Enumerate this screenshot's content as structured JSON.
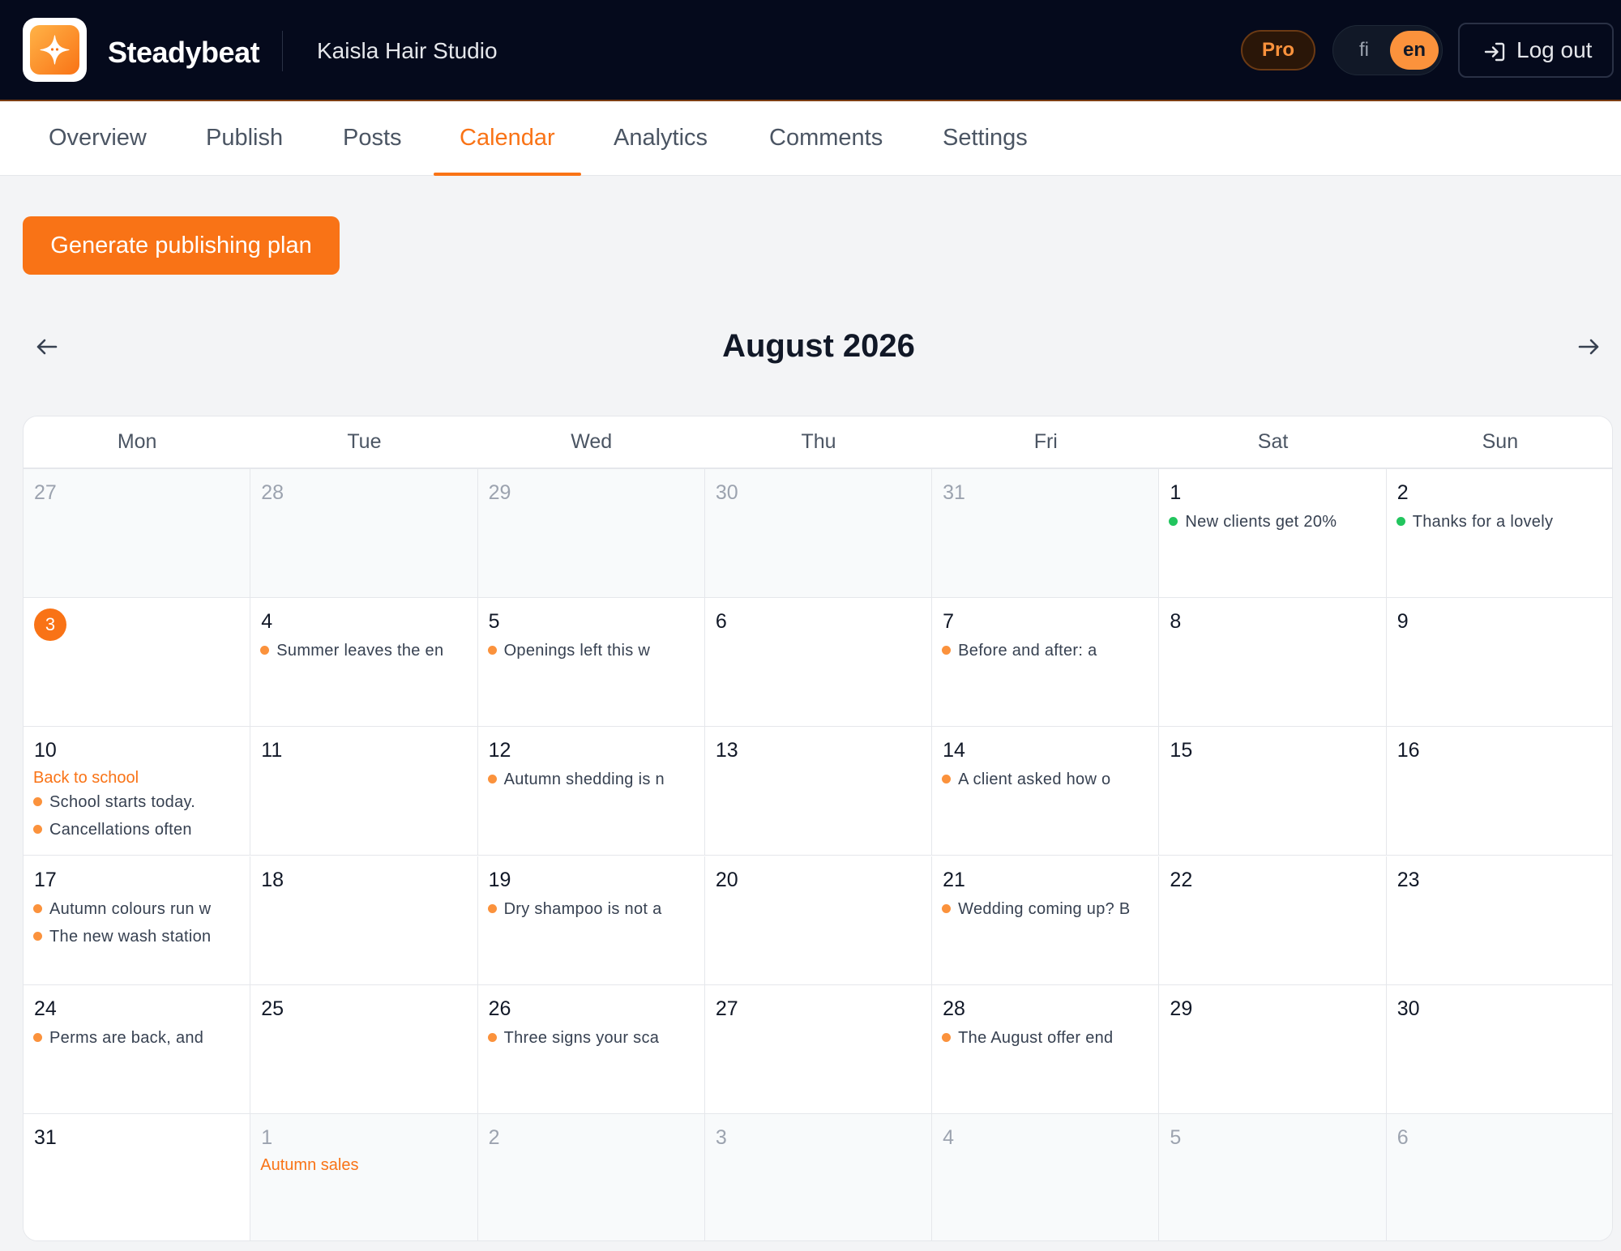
{
  "header": {
    "brand": "Steadybeat",
    "business": "Kaisla Hair Studio",
    "plan_badge": "Pro",
    "languages": [
      "fi",
      "en"
    ],
    "active_language": "en",
    "logout_label": "Log out"
  },
  "tabs": [
    {
      "label": "Overview"
    },
    {
      "label": "Publish"
    },
    {
      "label": "Posts"
    },
    {
      "label": "Calendar",
      "active": true
    },
    {
      "label": "Analytics"
    },
    {
      "label": "Comments"
    },
    {
      "label": "Settings"
    }
  ],
  "actions": {
    "generate_label": "Generate publishing plan"
  },
  "calendar": {
    "month_title": "August 2026",
    "weekdays": [
      "Mon",
      "Tue",
      "Wed",
      "Thu",
      "Fri",
      "Sat",
      "Sun"
    ],
    "colors": {
      "accent": "#f97316",
      "published": "#22c55e",
      "scheduled": "#fb923c"
    },
    "weeks": [
      [
        {
          "day": "27",
          "out": true,
          "posts": []
        },
        {
          "day": "28",
          "out": true,
          "posts": []
        },
        {
          "day": "29",
          "out": true,
          "posts": []
        },
        {
          "day": "30",
          "out": true,
          "posts": []
        },
        {
          "day": "31",
          "out": true,
          "posts": []
        },
        {
          "day": "1",
          "posts": [
            {
              "text": "New clients get 20%",
              "status": "published"
            }
          ]
        },
        {
          "day": "2",
          "posts": [
            {
              "text": "Thanks for a lovely",
              "status": "published"
            }
          ]
        }
      ],
      [
        {
          "day": "3",
          "today": true,
          "posts": []
        },
        {
          "day": "4",
          "posts": [
            {
              "text": "Summer leaves the en",
              "status": "scheduled"
            }
          ]
        },
        {
          "day": "5",
          "posts": [
            {
              "text": "Openings left this w",
              "status": "scheduled"
            }
          ]
        },
        {
          "day": "6",
          "posts": []
        },
        {
          "day": "7",
          "posts": [
            {
              "text": "Before and after: a",
              "status": "scheduled"
            }
          ]
        },
        {
          "day": "8",
          "posts": []
        },
        {
          "day": "9",
          "posts": []
        }
      ],
      [
        {
          "day": "10",
          "event": "Back to school",
          "posts": [
            {
              "text": "School starts today.",
              "status": "scheduled"
            },
            {
              "text": "Cancellations often",
              "status": "scheduled"
            }
          ]
        },
        {
          "day": "11",
          "posts": []
        },
        {
          "day": "12",
          "posts": [
            {
              "text": "Autumn shedding is n",
              "status": "scheduled"
            }
          ]
        },
        {
          "day": "13",
          "posts": []
        },
        {
          "day": "14",
          "posts": [
            {
              "text": "A client asked how o",
              "status": "scheduled"
            }
          ]
        },
        {
          "day": "15",
          "posts": []
        },
        {
          "day": "16",
          "posts": []
        }
      ],
      [
        {
          "day": "17",
          "posts": [
            {
              "text": "Autumn colours run w",
              "status": "scheduled"
            },
            {
              "text": "The new wash station",
              "status": "scheduled"
            }
          ]
        },
        {
          "day": "18",
          "posts": []
        },
        {
          "day": "19",
          "posts": [
            {
              "text": "Dry shampoo is not a",
              "status": "scheduled"
            }
          ]
        },
        {
          "day": "20",
          "posts": []
        },
        {
          "day": "21",
          "posts": [
            {
              "text": "Wedding coming up? B",
              "status": "scheduled"
            }
          ]
        },
        {
          "day": "22",
          "posts": []
        },
        {
          "day": "23",
          "posts": []
        }
      ],
      [
        {
          "day": "24",
          "posts": [
            {
              "text": "Perms are back, and",
              "status": "scheduled"
            }
          ]
        },
        {
          "day": "25",
          "posts": []
        },
        {
          "day": "26",
          "posts": [
            {
              "text": "Three signs your sca",
              "status": "scheduled"
            }
          ]
        },
        {
          "day": "27",
          "posts": []
        },
        {
          "day": "28",
          "posts": [
            {
              "text": "The August offer end",
              "status": "scheduled"
            }
          ]
        },
        {
          "day": "29",
          "posts": []
        },
        {
          "day": "30",
          "posts": []
        }
      ],
      [
        {
          "day": "31",
          "posts": []
        },
        {
          "day": "1",
          "out": true,
          "event": "Autumn sales",
          "posts": []
        },
        {
          "day": "2",
          "out": true,
          "posts": []
        },
        {
          "day": "3",
          "out": true,
          "posts": []
        },
        {
          "day": "4",
          "out": true,
          "posts": []
        },
        {
          "day": "5",
          "out": true,
          "posts": []
        },
        {
          "day": "6",
          "out": true,
          "posts": []
        }
      ]
    ]
  }
}
